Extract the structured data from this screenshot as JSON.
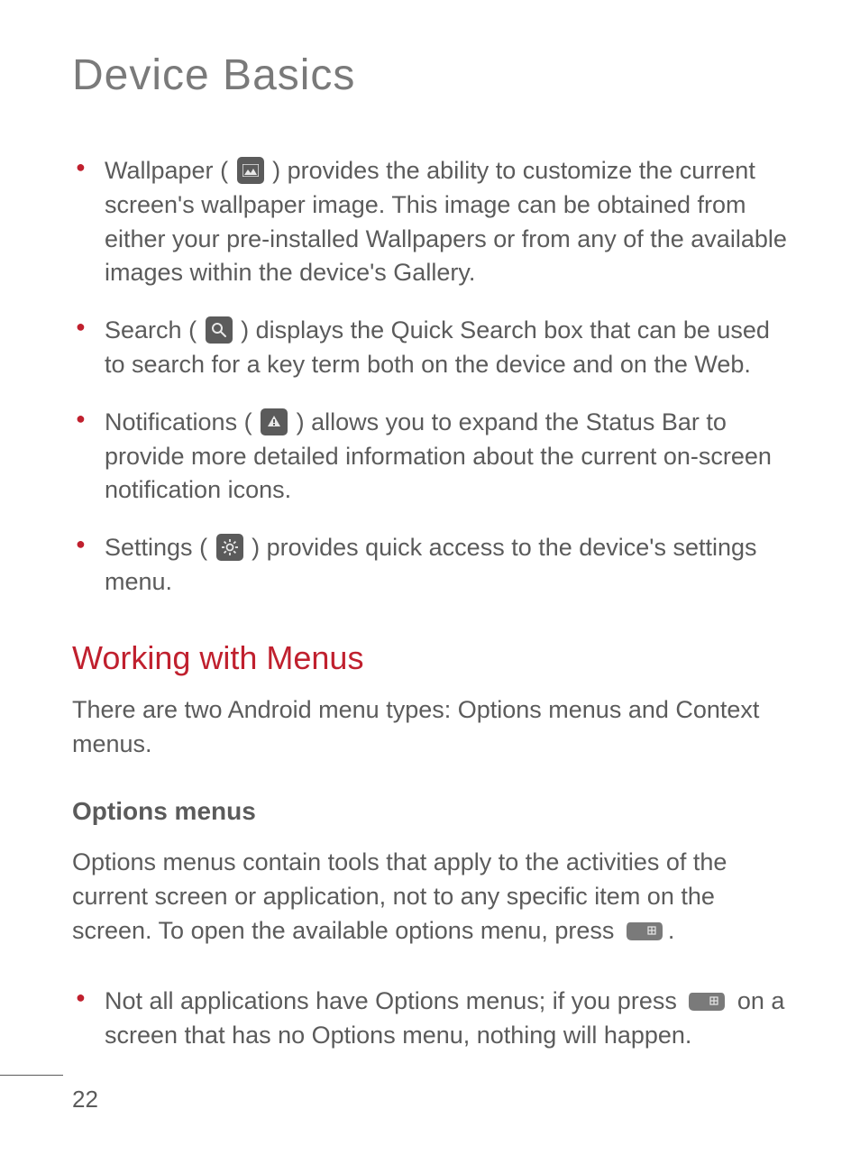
{
  "pageTitle": "Device Basics",
  "features": [
    {
      "term": "Wallpaper",
      "iconName": "wallpaper-icon",
      "text": " provides the ability to customize the current screen's wallpaper image. This image can be obtained from either your pre-installed Wallpapers or from any of the available images within the device's Gallery."
    },
    {
      "term": "Search",
      "iconName": "search-icon",
      "text": " displays the Quick Search box that can be used to search for a key term both on the device and on the Web."
    },
    {
      "term": "Notifications",
      "iconName": "notifications-icon",
      "text": " allows you to expand the Status Bar to provide more detailed information about the current on-screen notification icons."
    },
    {
      "term": "Settings",
      "iconName": "settings-icon",
      "text": " provides quick access to the device's settings menu."
    }
  ],
  "section": {
    "heading": "Working with Menus",
    "intro": "There are two Android menu types: Options menus and Context menus.",
    "subHeading": "Options menus",
    "subIntroBefore": "Options menus contain tools that apply to the activities of the current screen or application, not to any specific item on the screen. To open the available options menu, press ",
    "subIntroAfter": ".",
    "bullet": {
      "before": "Not all applications have Options menus; if you press ",
      "after": " on a screen that has no Options menu, nothing will happen."
    }
  },
  "pageNumber": "22"
}
